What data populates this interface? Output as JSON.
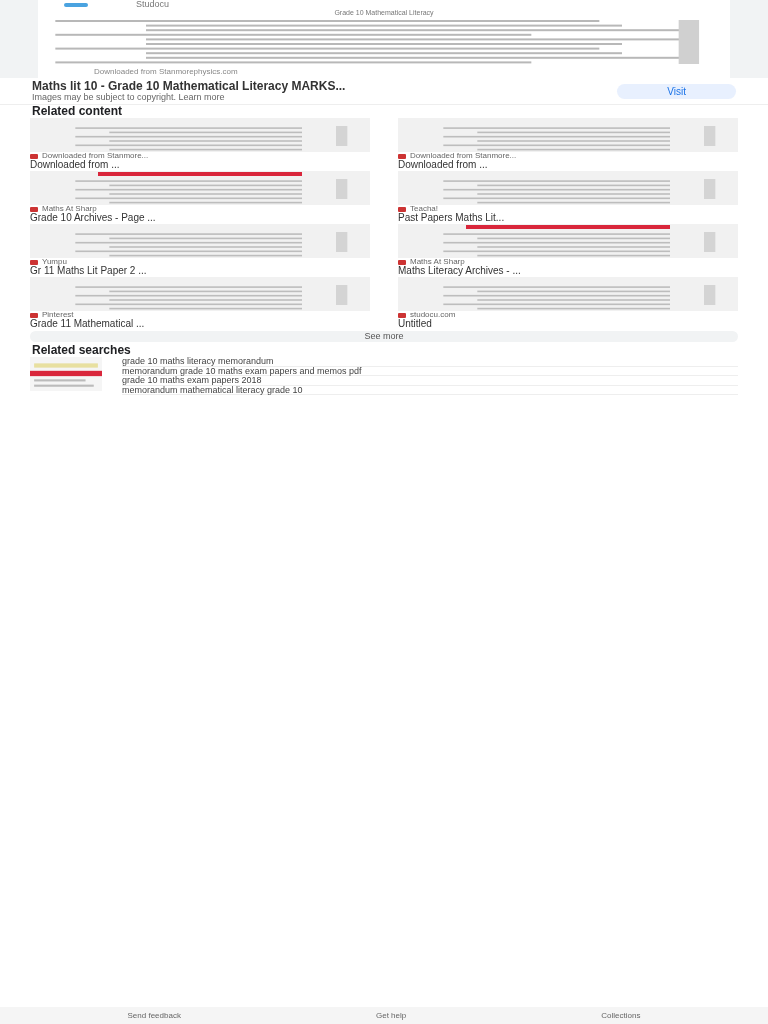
{
  "preview": {
    "source": "Studocu",
    "heading": "Grade 10 Mathematical Literacy",
    "caption": "Downloaded from Stanmorephysics.com"
  },
  "result": {
    "title": "Maths lit 10 - Grade 10 Mathematical Literacy MARKS...",
    "notice": "Images may be subject to copyright.",
    "learn_more": "Learn more",
    "visit": "Visit"
  },
  "related_content": {
    "heading": "Related content",
    "items": [
      {
        "source": "Downloaded from Stanmore...",
        "title": "Downloaded from ...",
        "accent": false
      },
      {
        "source": "Downloaded from Stanmore...",
        "title": "Downloaded from ...",
        "accent": false
      },
      {
        "source": "Maths At Sharp",
        "title": "Grade 10 Archives - Page ...",
        "accent": true
      },
      {
        "source": "Teacha!",
        "title": "Past Papers Maths Lit...",
        "accent": false
      },
      {
        "source": "Yumpu",
        "title": "Gr 11 Maths Lit Paper 2 ...",
        "accent": false
      },
      {
        "source": "Maths At Sharp",
        "title": "Maths Literacy Archives - ...",
        "accent": true
      },
      {
        "source": "Pinterest",
        "title": "Grade 11 Mathematical ...",
        "accent": false
      },
      {
        "source": "studocu.com",
        "title": "Untitled",
        "accent": false
      }
    ],
    "see_more": "See more"
  },
  "related_searches": {
    "heading": "Related searches",
    "items": [
      "grade 10 maths literacy memorandum",
      "memorandum grade 10 maths exam papers and memos pdf",
      "grade 10 maths exam papers 2018",
      "memorandum mathematical literacy grade 10"
    ]
  },
  "footer": [
    "Send feedback",
    "Get help",
    "Collections"
  ]
}
